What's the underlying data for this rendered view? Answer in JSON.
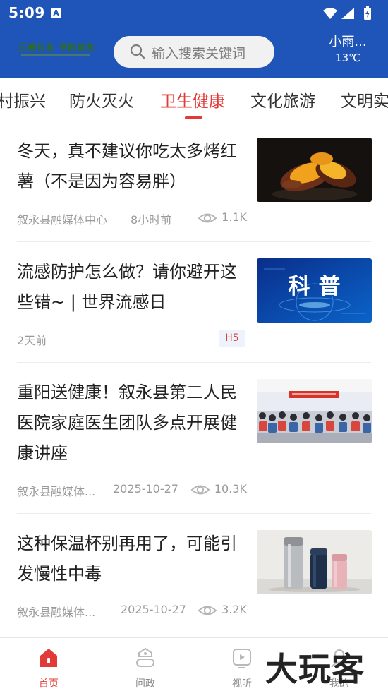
{
  "status_bar": {
    "time": "5:09",
    "notif_letter": "A"
  },
  "header": {
    "logo_text": "乐善何永 书韵叙永",
    "search_placeholder": "输入搜索关键词",
    "weather_desc": "小雨...",
    "weather_temp": "13℃"
  },
  "tabs": [
    {
      "label": "村振兴"
    },
    {
      "label": "防火灭火"
    },
    {
      "label": "卫生健康"
    },
    {
      "label": "文化旅游"
    },
    {
      "label": "文明实"
    }
  ],
  "articles": [
    {
      "title": "冬天，真不建议你吃太多烤红薯（不是因为容易胖）",
      "source": "叙永县融媒体中心",
      "time": "8小时前",
      "views": "1.1K"
    },
    {
      "title": "流感防护怎么做？请你避开这些错~ | 世界流感日",
      "time": "2天前",
      "badge": "H5",
      "thumb_text": "科普"
    },
    {
      "title": "重阳送健康！叙永县第二人民医院家庭医生团队多点开展健康讲座",
      "source": "叙永县融媒体...",
      "time": "2025-10-27",
      "views": "10.3K"
    },
    {
      "title": "这种保温杯别再用了，可能引发慢性中毒",
      "source": "叙永县融媒体...",
      "time": "2025-10-27",
      "views": "3.2K"
    }
  ],
  "bottom_nav": [
    {
      "label": "首页",
      "icon": "home-icon"
    },
    {
      "label": "问政",
      "icon": "politics-icon"
    },
    {
      "label": "视听",
      "icon": "tv-icon"
    },
    {
      "label": "我的",
      "icon": "profile-icon"
    }
  ],
  "watermark": "大玩客",
  "colors": {
    "brand_blue": "#1f55b8",
    "accent_red": "#e23a36",
    "meta_gray": "#9a9a9a"
  }
}
